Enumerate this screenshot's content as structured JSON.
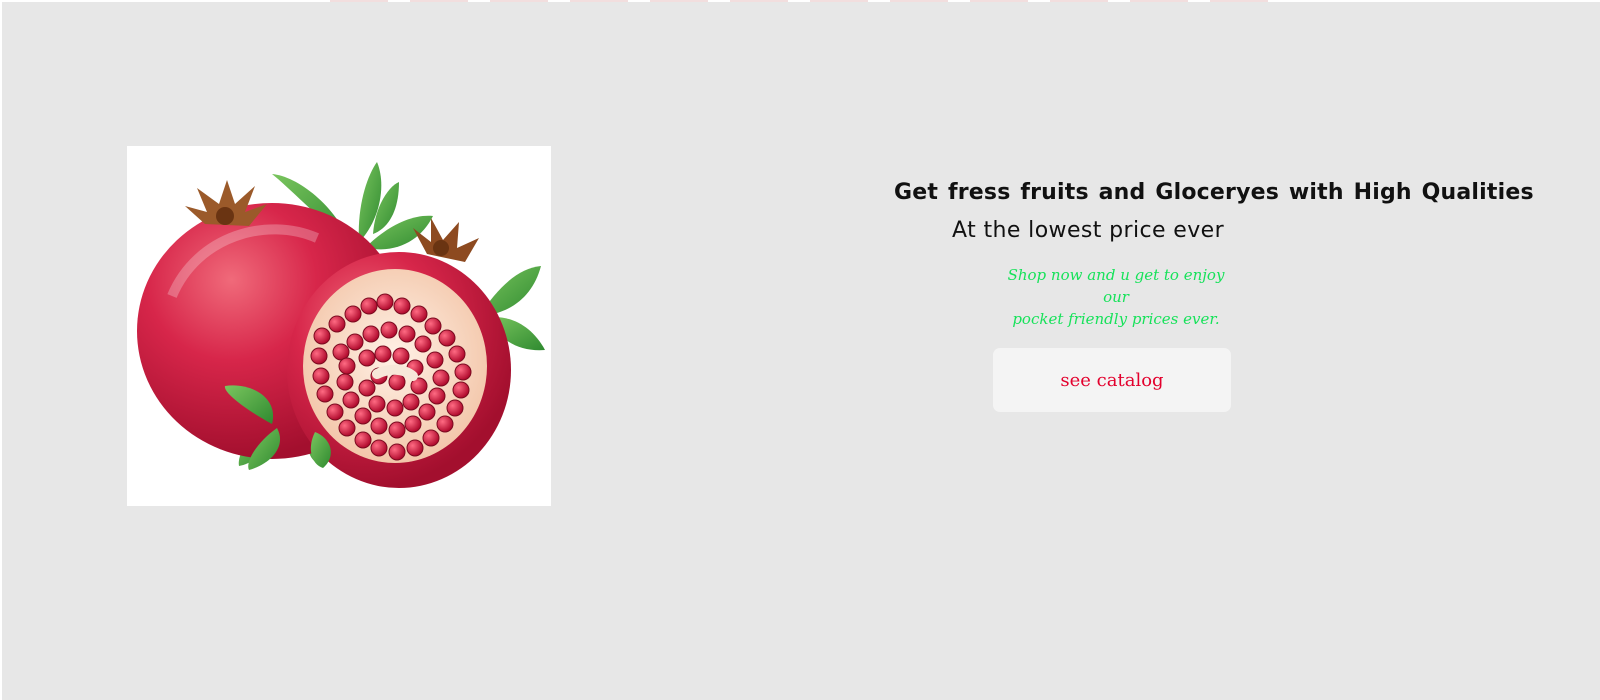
{
  "hero": {
    "headline": "Get fress fruits  and Gloceryes with High Qualities",
    "subheadline": "At the lowest price ever",
    "promo_line_1": "Shop now and u get to enjoy our",
    "promo_line_2": "pocket friendly prices ever.",
    "cta_label": "see catalog",
    "image_subject": "pomegranate-photo"
  },
  "colors": {
    "background": "#e7e7e7",
    "headline": "#111111",
    "promo": "#17e25a",
    "cta_text": "#e3002d",
    "cta_background": "#f4f4f4"
  }
}
